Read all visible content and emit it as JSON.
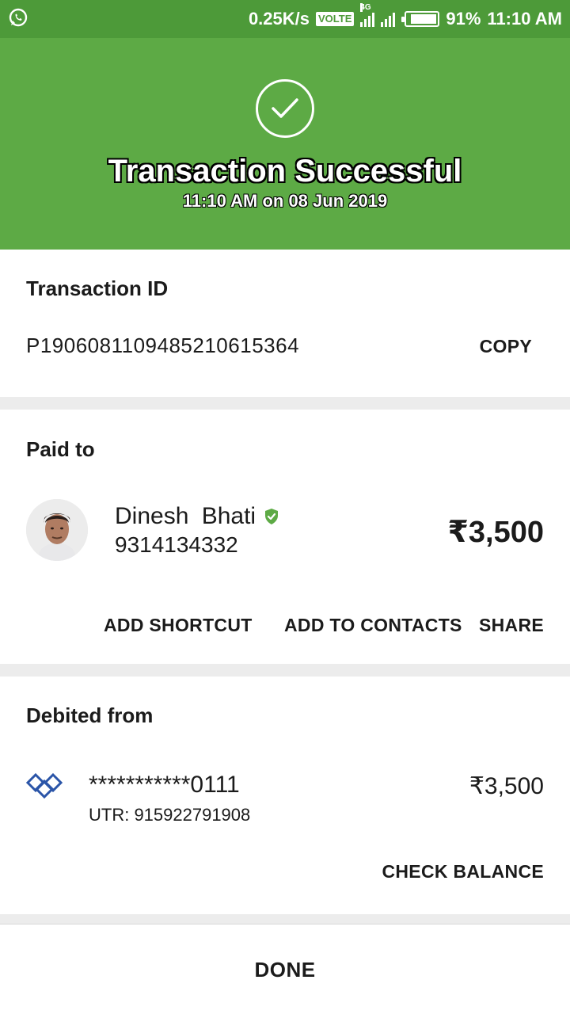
{
  "status_bar": {
    "network_speed": "0.25K/s",
    "volte": "VOLTE",
    "network_type": "4G",
    "battery": "91%",
    "time": "11:10 AM",
    "battery_level": 0.91
  },
  "header": {
    "title": "Transaction Successful",
    "subtitle": "11:10 AM on 08 Jun 2019",
    "background_color": "#5daa45"
  },
  "transaction": {
    "label": "Transaction ID",
    "id": "P1906081109485210615364",
    "copy_label": "COPY"
  },
  "paid_to": {
    "label": "Paid to",
    "name": "Dinesh  Bhati",
    "phone": "9314134332",
    "amount": "₹3,500",
    "actions": {
      "add_shortcut": "ADD SHORTCUT",
      "add_to_contacts": "ADD TO CONTACTS",
      "share": "SHARE"
    }
  },
  "debited_from": {
    "label": "Debited from",
    "account": "***********0111",
    "utr": "UTR: 915922791908",
    "amount": "₹3,500",
    "check_balance": "CHECK BALANCE"
  },
  "footer": {
    "done_label": "DONE"
  }
}
